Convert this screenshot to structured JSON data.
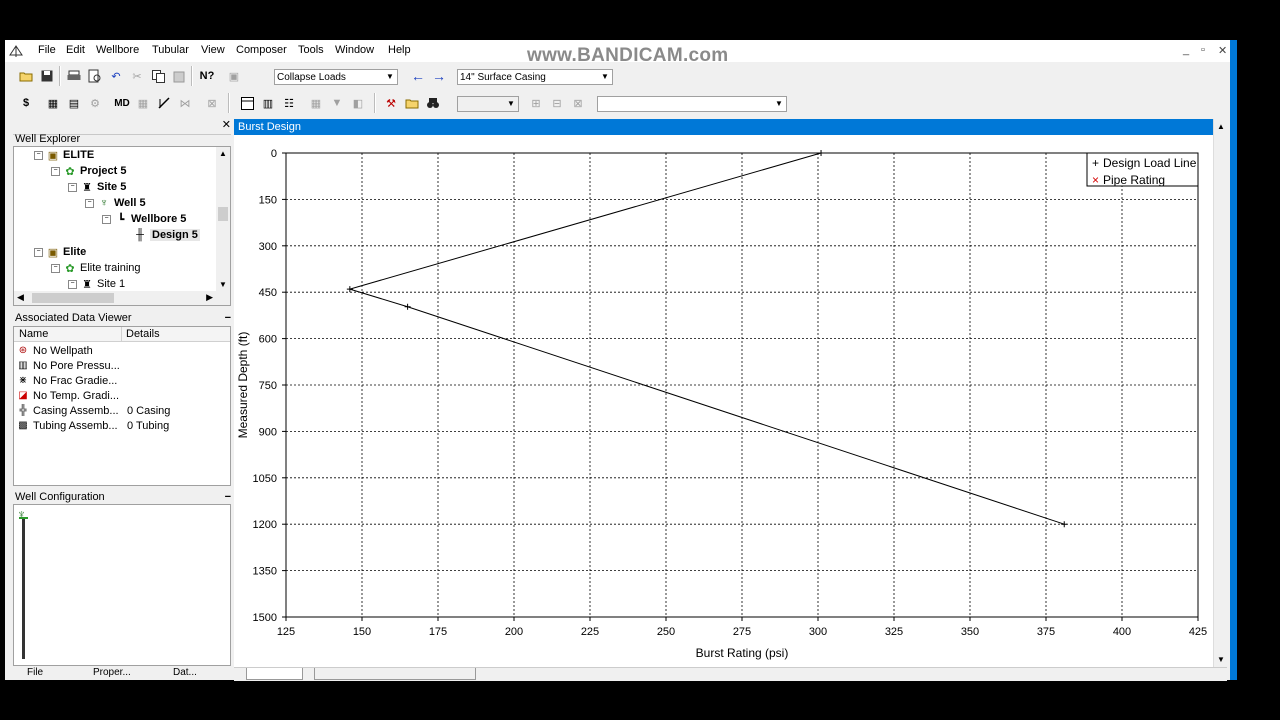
{
  "watermark": "www.BANDICAM.com",
  "menu": [
    "File",
    "Edit",
    "Wellbore",
    "Tubular",
    "View",
    "Composer",
    "Tools",
    "Window",
    "Help"
  ],
  "window_controls": [
    "_",
    "▫",
    "✕"
  ],
  "toolbar1": {
    "load_combo": "Collapse Loads",
    "casing_combo": "14\" Surface Casing"
  },
  "toolbar2": {
    "md_label": "MD"
  },
  "well_explorer": {
    "title": "Well Explorer",
    "items": [
      {
        "label": "ELITE",
        "bold": true
      },
      {
        "label": "Project 5",
        "bold": true
      },
      {
        "label": "Site 5",
        "bold": true
      },
      {
        "label": "Well 5",
        "bold": true
      },
      {
        "label": "Wellbore 5",
        "bold": true
      },
      {
        "label": "Design 5",
        "bold": true
      },
      {
        "label": "Elite",
        "bold": true
      },
      {
        "label": "Elite training",
        "bold": false
      },
      {
        "label": "Site 1",
        "bold": false
      }
    ]
  },
  "data_viewer": {
    "title": "Associated Data Viewer",
    "columns": [
      "Name",
      "Details"
    ],
    "rows": [
      {
        "name": "No Wellpath",
        "details": "",
        "icon": "compass-icon"
      },
      {
        "name": "No Pore Pressu...",
        "details": "",
        "icon": "pressure-icon"
      },
      {
        "name": "No Frac Gradie...",
        "details": "",
        "icon": "frac-icon"
      },
      {
        "name": "No Temp. Gradi...",
        "details": "",
        "icon": "temperature-icon"
      },
      {
        "name": "Casing Assemb...",
        "details": "0 Casing",
        "icon": "casing-icon"
      },
      {
        "name": "Tubing Assemb...",
        "details": "0 Tubing",
        "icon": "tubing-icon"
      }
    ]
  },
  "well_config": {
    "title": "Well Configuration"
  },
  "plot_window": {
    "title": "Burst Design"
  },
  "chart_data": {
    "type": "line",
    "xlabel": "Burst Rating (psi)",
    "ylabel": "Measured Depth (ft)",
    "xlim": [
      125,
      425
    ],
    "ylim": [
      0,
      1500
    ],
    "y_inverted": true,
    "x_ticks": [
      125,
      150,
      175,
      200,
      225,
      250,
      275,
      300,
      325,
      350,
      375,
      400,
      425
    ],
    "y_ticks": [
      0,
      150,
      300,
      450,
      600,
      750,
      900,
      1050,
      1200,
      1350,
      1500
    ],
    "grid": true,
    "legend_position": "top-right",
    "series": [
      {
        "name": "Design Load Line",
        "marker": "+",
        "color": "#000000",
        "points": [
          [
            301,
            0
          ],
          [
            146,
            440
          ],
          [
            165,
            497
          ],
          [
            381,
            1200
          ]
        ]
      },
      {
        "name": "Pipe Rating",
        "marker": "×",
        "color": "#d40000",
        "points": []
      }
    ]
  },
  "bottom_tabs": [
    "File",
    "Proper...",
    "Dat..."
  ]
}
